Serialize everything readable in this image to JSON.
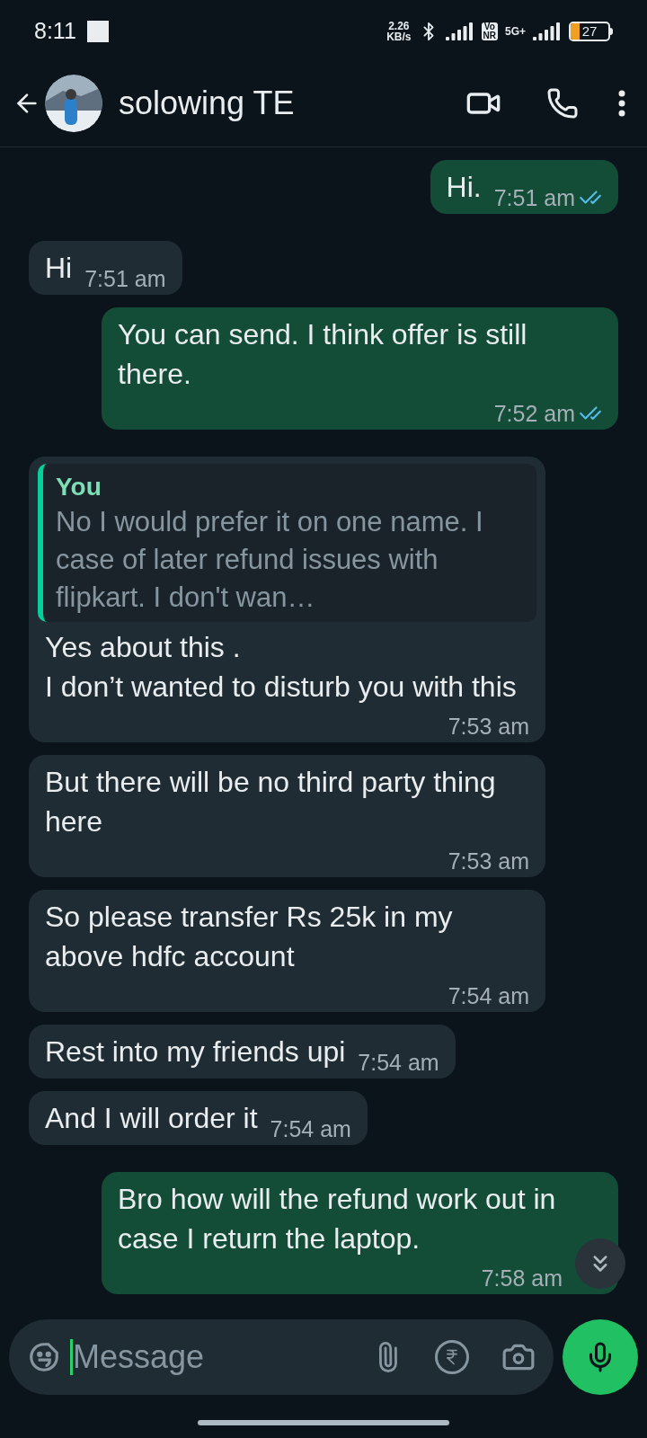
{
  "status_bar": {
    "time": "8:11",
    "speed_value": "2.26",
    "speed_unit": "KB/s",
    "volte_top": "Vo",
    "volte_bottom": "NR",
    "network": "5G+",
    "battery": "27"
  },
  "header": {
    "contact_name": "solowing TE"
  },
  "messages": [
    {
      "kind": "sent",
      "text": "Hi.",
      "time": "7:51 am",
      "read": true
    },
    {
      "kind": "received",
      "text": "Hi",
      "time": "7:51 am"
    },
    {
      "kind": "sent",
      "text": "You can send. I think offer is still there.",
      "time": "7:52 am",
      "read": true
    },
    {
      "kind": "received",
      "quote": {
        "author": "You",
        "text": "No I would prefer it on one name. I case of later refund issues with flipkart. I don't wan…"
      },
      "text": "Yes about this .\nI don’t wanted to disturb you with this",
      "time": "7:53 am"
    },
    {
      "kind": "received",
      "text": "But there will be no third party thing here",
      "time": "7:53 am"
    },
    {
      "kind": "received",
      "text": "So please transfer Rs 25k in my above hdfc account",
      "time": "7:54 am"
    },
    {
      "kind": "received",
      "text": "Rest into my friends upi",
      "time": "7:54 am"
    },
    {
      "kind": "received",
      "text": "And I will order it",
      "time": "7:54 am"
    },
    {
      "kind": "sent",
      "text": "Bro how will the refund  work out in case I return the laptop.",
      "time": "7:58 am"
    }
  ],
  "composer": {
    "placeholder": "Message"
  }
}
